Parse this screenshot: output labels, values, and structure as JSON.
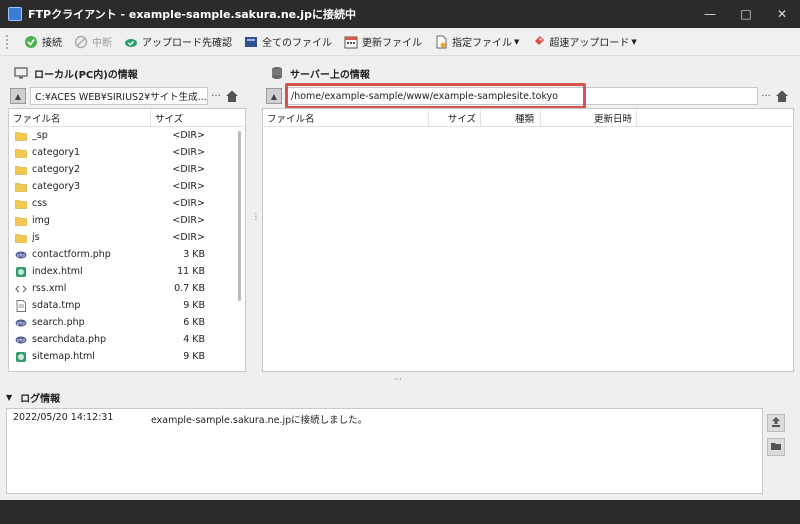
{
  "window": {
    "title": "FTPクライアント - example-sample.sakura.ne.jpに接続中",
    "min": "—",
    "max": "□",
    "close": "✕"
  },
  "toolbar": {
    "connect": "接続",
    "abort": "中断",
    "upload_dest": "アップロード先確認",
    "all_files": "全てのファイル",
    "updated_files": "更新ファイル",
    "specified_files": "指定ファイル",
    "fast_upload": "超速アップロード"
  },
  "local": {
    "header": "ローカル(PC内)の情報",
    "path": "C:¥ACES WEB¥SIRIUS2¥サイト生成...",
    "dots": "···",
    "col_name": "ファイル名",
    "col_size": "サイズ",
    "files": [
      {
        "name": "_sp",
        "size": "<DIR>",
        "icon": "folder"
      },
      {
        "name": "category1",
        "size": "<DIR>",
        "icon": "folder"
      },
      {
        "name": "category2",
        "size": "<DIR>",
        "icon": "folder"
      },
      {
        "name": "category3",
        "size": "<DIR>",
        "icon": "folder"
      },
      {
        "name": "css",
        "size": "<DIR>",
        "icon": "folder"
      },
      {
        "name": "img",
        "size": "<DIR>",
        "icon": "folder"
      },
      {
        "name": "js",
        "size": "<DIR>",
        "icon": "folder"
      },
      {
        "name": "contactform.php",
        "size": "3 KB",
        "icon": "php"
      },
      {
        "name": "index.html",
        "size": "11 KB",
        "icon": "html"
      },
      {
        "name": "rss.xml",
        "size": "0.7 KB",
        "icon": "xml"
      },
      {
        "name": "sdata.tmp",
        "size": "9 KB",
        "icon": "doc"
      },
      {
        "name": "search.php",
        "size": "6 KB",
        "icon": "php"
      },
      {
        "name": "searchdata.php",
        "size": "4 KB",
        "icon": "php"
      },
      {
        "name": "sitemap.html",
        "size": "9 KB",
        "icon": "html"
      }
    ]
  },
  "server": {
    "header": "サーバー上の情報",
    "path": "/home/example-sample/www/example-samplesite.tokyo",
    "dots": "···",
    "col_name": "ファイル名",
    "col_size": "サイズ",
    "col_type": "種類",
    "col_date": "更新日時"
  },
  "log": {
    "header": "ログ情報",
    "entries": [
      {
        "time": "2022/05/20 14:12:31",
        "message": "example-sample.sakura.ne.jpに接続しました。"
      }
    ]
  },
  "colors": {
    "titlebar": "#2b2b2b",
    "highlight": "#d9534f",
    "folder": "#f2c94c"
  }
}
